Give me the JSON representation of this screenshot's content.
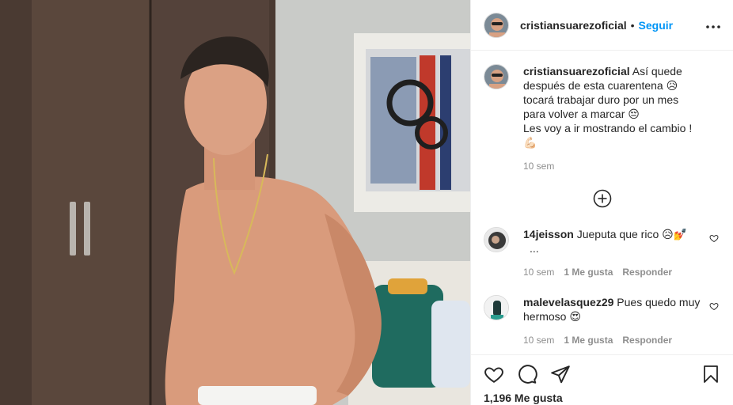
{
  "post": {
    "photo_alt": "post-photo",
    "author": "cristiansuarezoficial",
    "separator": "•",
    "follow_label": "Seguir",
    "more_label": "•••",
    "caption_text_1": "Así quede después de esta cuarentena 😥tocará trabajar duro por un mes para volver a marcar 😔",
    "caption_text_2": "Les voy a ir mostrando el cambio ! 💪🏻",
    "caption_time": "10 sem",
    "likes": "1,196 Me gusta"
  },
  "comments": [
    {
      "user": "14jeisson",
      "text": "Jueputa que rico 😥💅",
      "time": "10 sem",
      "likes": "1 Me gusta",
      "reply": "Responder",
      "more": "..."
    },
    {
      "user": "malevelasquez29",
      "text": "Pues quedo muy hermoso 😍",
      "time": "10 sem",
      "likes": "1 Me gusta",
      "reply": "Responder"
    }
  ],
  "colors": {
    "accent": "#0095f6",
    "text": "#262626",
    "muted": "#8e8e8e",
    "border": "#efefef"
  },
  "icons": [
    "more-icon",
    "plus-circle-icon",
    "heart-icon",
    "comment-icon",
    "share-icon",
    "bookmark-icon"
  ]
}
